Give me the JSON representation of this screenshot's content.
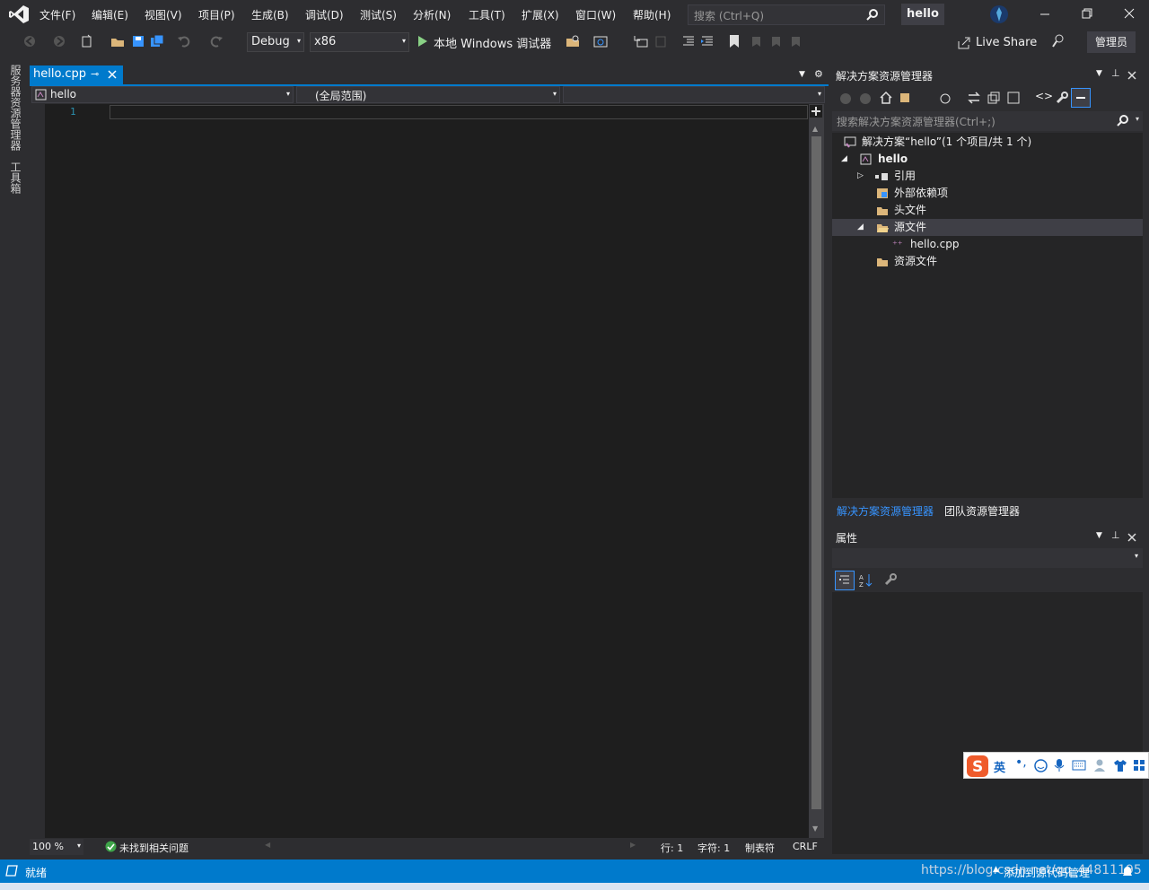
{
  "menu": [
    "文件(F)",
    "编辑(E)",
    "视图(V)",
    "项目(P)",
    "生成(B)",
    "调试(D)",
    "测试(S)",
    "分析(N)",
    "工具(T)",
    "扩展(X)",
    "窗口(W)",
    "帮助(H)"
  ],
  "search_placeholder": "搜索 (Ctrl+Q)",
  "solution_name": "hello",
  "toolbar": {
    "config": "Debug",
    "platform": "x86",
    "run_label": "本地 Windows 调试器",
    "live_share": "Live Share",
    "admin": "管理员"
  },
  "left_strip": {
    "server_explorer": "服务器资源管理器",
    "toolbox": "工具箱"
  },
  "editor": {
    "tab_label": "hello.cpp",
    "nav_project": "hello",
    "nav_scope": "(全局范围)",
    "line_number": "1",
    "zoom": "100 %",
    "issues": "未找到相关问题",
    "row": "行: 1",
    "col": "字符: 1",
    "tab_mode": "制表符",
    "eol": "CRLF"
  },
  "solution_explorer": {
    "title": "解决方案资源管理器",
    "search_placeholder": "搜索解决方案资源管理器(Ctrl+;)",
    "tree": [
      {
        "label": "解决方案“hello”(1 个项目/共 1 个)"
      },
      {
        "label": "hello"
      },
      {
        "label": "引用"
      },
      {
        "label": "外部依赖项"
      },
      {
        "label": "头文件"
      },
      {
        "label": "源文件"
      },
      {
        "label": "hello.cpp"
      },
      {
        "label": "资源文件"
      }
    ],
    "tab_active": "解决方案资源管理器",
    "tab_other": "团队资源管理器"
  },
  "properties": {
    "title": "属性"
  },
  "status": {
    "ready": "就绪",
    "source_control": "添加到源代码管理",
    "watermark": "https://blog.csdn.net/qq_44811195"
  },
  "ime": {
    "lang": "英"
  },
  "colors": {
    "accent": "#007acc",
    "bg": "#2d2d30",
    "editor": "#1e1e1e"
  }
}
